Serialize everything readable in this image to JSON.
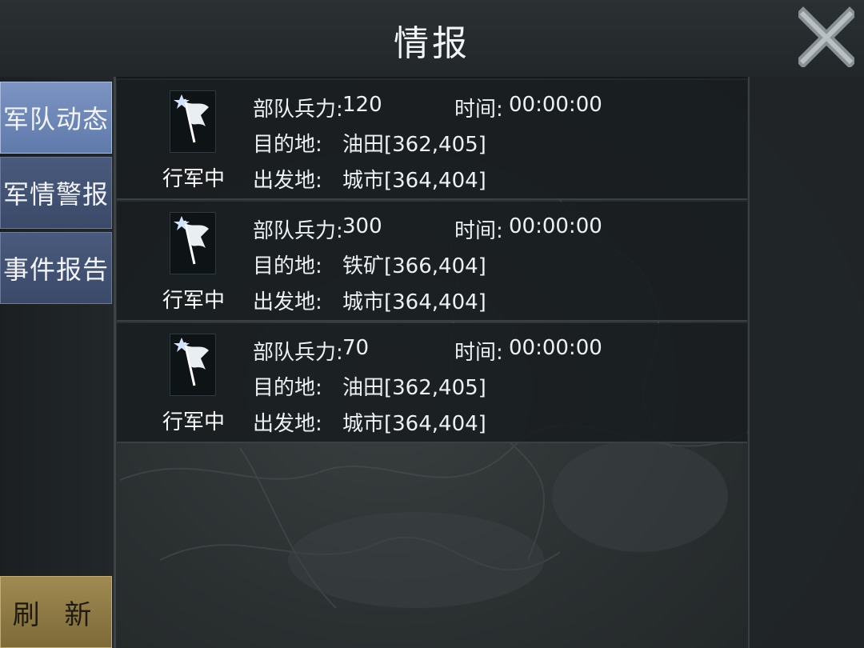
{
  "title": "情报",
  "sidebar": {
    "tabs": [
      {
        "label": "军队动态",
        "active": true
      },
      {
        "label": "军情警报",
        "active": false
      },
      {
        "label": "事件报告",
        "active": false
      }
    ],
    "refresh_label": "刷 新"
  },
  "labels": {
    "troops": "部队兵力:",
    "time": "时间:",
    "destination": "目的地:",
    "origin": "出发地:"
  },
  "entries": [
    {
      "status": "行军中",
      "troops": "120",
      "time": "00:00:00",
      "destination": "油田[362,405]",
      "origin": "城市[364,404]"
    },
    {
      "status": "行军中",
      "troops": "300",
      "time": "00:00:00",
      "destination": "铁矿[366,404]",
      "origin": "城市[364,404]"
    },
    {
      "status": "行军中",
      "troops": "70",
      "time": "00:00:00",
      "destination": "油田[362,405]",
      "origin": "城市[364,404]"
    }
  ],
  "colors": {
    "tab_active": "#6f88b8",
    "tab": "#43526f",
    "refresh": "#917c47"
  }
}
